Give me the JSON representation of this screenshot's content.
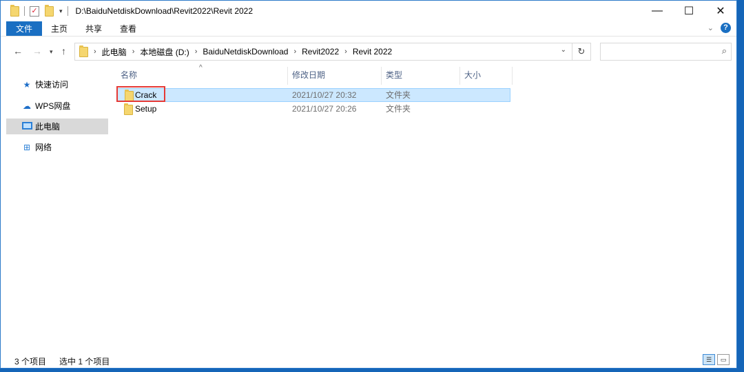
{
  "window": {
    "title_path": "D:\\BaiduNetdiskDownload\\Revit2022\\Revit 2022",
    "controls": {
      "minimize": "—",
      "maximize": "☐",
      "close": "✕"
    }
  },
  "ribbon": {
    "tabs": [
      "文件",
      "主页",
      "共享",
      "查看"
    ]
  },
  "address": {
    "crumbs": [
      "此电脑",
      "本地磁盘 (D:)",
      "BaiduNetdiskDownload",
      "Revit2022",
      "Revit 2022"
    ],
    "search_placeholder": ""
  },
  "sidebar": {
    "items": [
      {
        "label": "快速访问",
        "icon": "star-icon"
      },
      {
        "label": "WPS网盘",
        "icon": "cloud-icon"
      },
      {
        "label": "此电脑",
        "icon": "computer-icon"
      },
      {
        "label": "网络",
        "icon": "network-icon"
      }
    ]
  },
  "table": {
    "columns": [
      "名称",
      "修改日期",
      "类型",
      "大小"
    ],
    "rows": [
      {
        "name": "Crack",
        "date": "2021/10/27 20:32",
        "type": "文件夹",
        "size": ""
      },
      {
        "name": "Setup",
        "date": "2021/10/27 20:26",
        "type": "文件夹",
        "size": ""
      }
    ]
  },
  "status": {
    "count": "3 个项目",
    "selected": "选中 1 个项目"
  },
  "colors": {
    "accent": "#1a6fc2",
    "selection": "#cce8ff",
    "highlight_box": "#e53935"
  }
}
